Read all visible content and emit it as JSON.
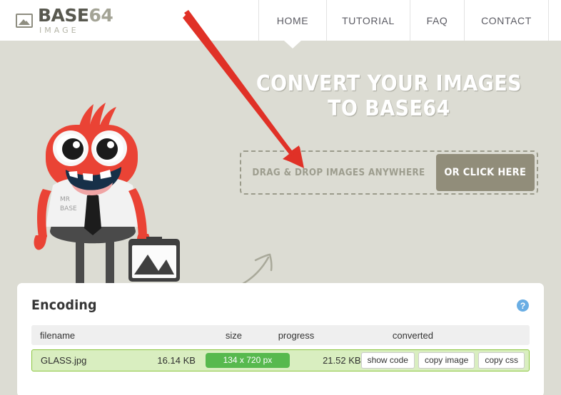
{
  "header": {
    "logo": {
      "mark_icon": "image-icon",
      "title_primary": "BASE",
      "title_secondary": "64",
      "subtitle": "IMAGE"
    },
    "nav": [
      {
        "label": "HOME",
        "active": true
      },
      {
        "label": "TUTORIAL",
        "active": false
      },
      {
        "label": "FAQ",
        "active": false
      },
      {
        "label": "CONTACT",
        "active": false
      }
    ]
  },
  "hero": {
    "title_line1": "CONVERT YOUR IMAGES",
    "title_line2": "TO BASE64",
    "dropzone": {
      "label": "DRAG & DROP IMAGES ANYWHERE",
      "button_label": "OR CLICK HERE"
    },
    "mascot": {
      "shirt_line1": "MR",
      "shirt_line2": "BASE"
    },
    "annotation_arrow": "red-arrow-pointer",
    "decorative_arrow": "curved-arrow"
  },
  "encoding": {
    "title": "Encoding",
    "help_label": "?",
    "columns": [
      "filename",
      "size",
      "progress",
      "converted",
      ""
    ],
    "rows": [
      {
        "filename": "GLASS.jpg",
        "size": "16.14 KB",
        "progress": "134 x 720 px",
        "converted": "21.52 KB",
        "actions": [
          "show code",
          "copy image",
          "copy css"
        ]
      }
    ]
  },
  "colors": {
    "page_background": "#dcdcd3",
    "header_background": "#ffffff",
    "accent_button": "#918d7a",
    "progress_green": "#57b94e",
    "row_green_background": "#d9eec0",
    "row_green_border": "#8cc63f",
    "help_blue": "#6aaee4",
    "annotation_red": "#e03127",
    "mascot_red": "#ea4335"
  }
}
